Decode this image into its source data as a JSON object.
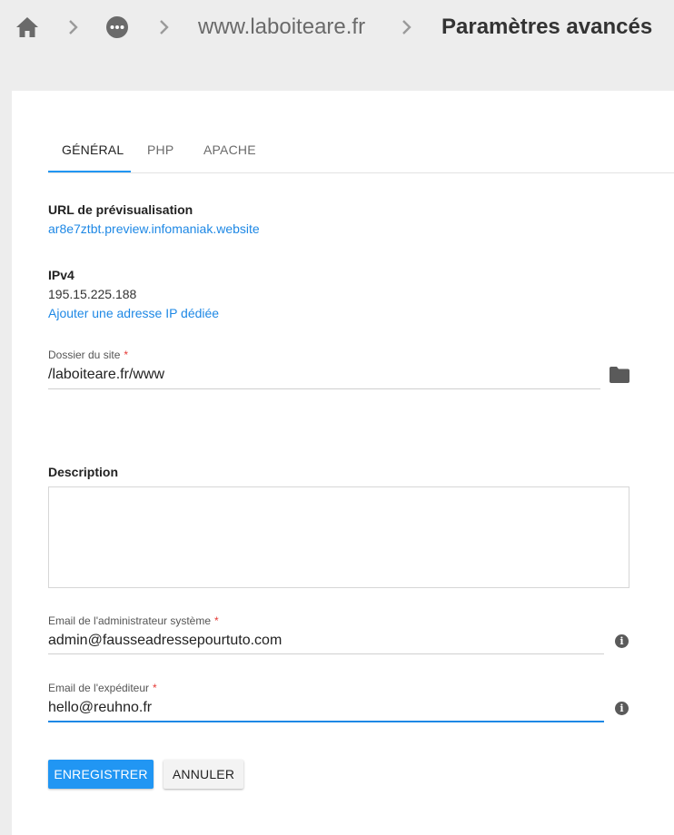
{
  "breadcrumb": {
    "home_icon": "home-icon",
    "more_icon": "more-horizontal-icon",
    "separator": ">",
    "site": "www.laboiteare.fr",
    "current": "Paramètres avancés"
  },
  "tabs": [
    {
      "label": "GÉNÉRAL",
      "active": true
    },
    {
      "label": "PHP",
      "active": false
    },
    {
      "label": "APACHE",
      "active": false
    }
  ],
  "general": {
    "preview_url_label": "URL de prévisualisation",
    "preview_url": "ar8e7ztbt.preview.infomaniak.website",
    "ipv4_label": "IPv4",
    "ipv4_value": "195.15.225.188",
    "add_ip_link": "Ajouter une adresse IP dédiée",
    "site_folder_label": "Dossier du site",
    "site_folder_value": "/laboiteare.fr/www",
    "required_mark": "*",
    "description_label": "Description",
    "description_value": "",
    "admin_email_label": "Email de l'administrateur système",
    "admin_email_value": "admin@fausseadressepourtuto.com",
    "sender_email_label": "Email de l'expéditeur",
    "sender_email_value": "hello@reuhno.fr"
  },
  "actions": {
    "save_label": "ENREGISTRER",
    "cancel_label": "ANNULER"
  },
  "colors": {
    "accent": "#2196f3",
    "link": "#1e88e5",
    "required": "#e53935"
  }
}
